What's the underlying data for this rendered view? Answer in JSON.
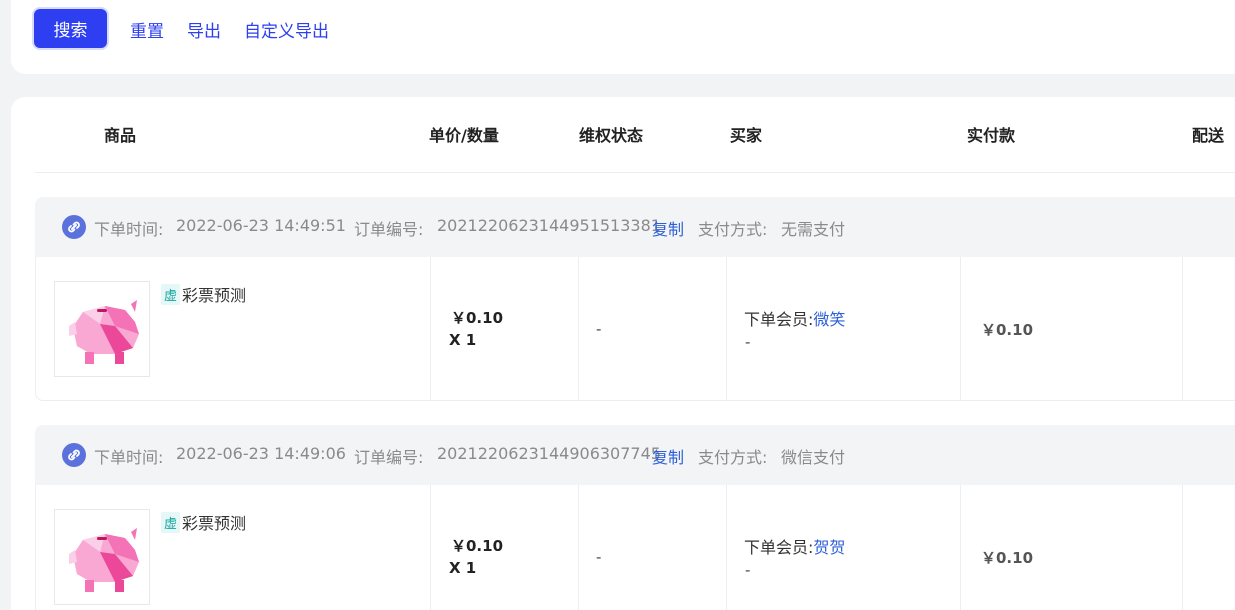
{
  "toolbar": {
    "search_label": "搜索",
    "reset_label": "重置",
    "export_label": "导出",
    "custom_export_label": "自定义导出"
  },
  "table": {
    "columns": [
      "商品",
      "单价/数量",
      "维权状态",
      "买家",
      "实付款",
      "配送"
    ]
  },
  "orders": [
    {
      "time_label": "下单时间:",
      "time": "2022-06-23 14:49:51",
      "number_label": "订单编号:",
      "number": "2021220623144951513381",
      "copy_label": "复制",
      "pay_label": "支付方式:",
      "pay_method": "无需支付",
      "product_tag": "虚",
      "product_name": "彩票预测",
      "unit_price": "￥0.10",
      "quantity": "X 1",
      "rights_status": "-",
      "buyer_label": "下单会员:",
      "buyer_name": "微笑",
      "buyer_extra": "-",
      "paid_amount": "￥0.10"
    },
    {
      "time_label": "下单时间:",
      "time": "2022-06-23 14:49:06",
      "number_label": "订单编号:",
      "number": "2021220623144906307745",
      "copy_label": "复制",
      "pay_label": "支付方式:",
      "pay_method": "微信支付",
      "product_tag": "虚",
      "product_name": "彩票预测",
      "unit_price": "￥0.10",
      "quantity": "X 1",
      "rights_status": "-",
      "buyer_label": "下单会员:",
      "buyer_name": "贺贺",
      "buyer_extra": "-",
      "paid_amount": "￥0.10"
    }
  ],
  "colors": {
    "primary": "#2d3ff0",
    "link": "#2d5fd8",
    "tag": "#16a6a0"
  }
}
